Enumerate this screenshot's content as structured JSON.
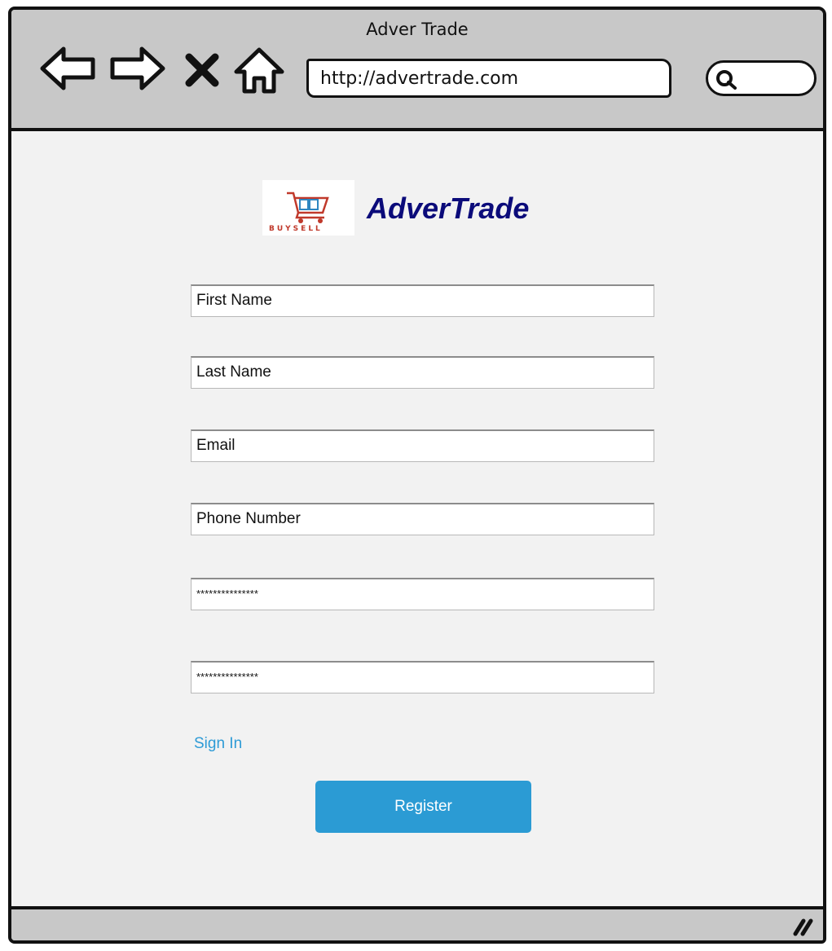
{
  "window": {
    "title": "Adver Trade"
  },
  "nav": {
    "back_icon": "arrow-left-icon",
    "forward_icon": "arrow-right-icon",
    "stop_icon": "close-icon",
    "home_icon": "home-icon"
  },
  "address_bar": {
    "url": "http://advertrade.com"
  },
  "search": {
    "icon": "search-icon"
  },
  "brand": {
    "name": "AdverTrade",
    "logo_caption": "BUYSELL"
  },
  "form": {
    "first_name": "First Name",
    "last_name": "Last Name",
    "email": "Email",
    "phone": "Phone Number",
    "password": "***************",
    "confirm_password": "***************"
  },
  "links": {
    "sign_in": "Sign In"
  },
  "actions": {
    "register": "Register"
  },
  "colors": {
    "accent": "#2b9bd4",
    "brand_text": "#0b0b7a"
  }
}
